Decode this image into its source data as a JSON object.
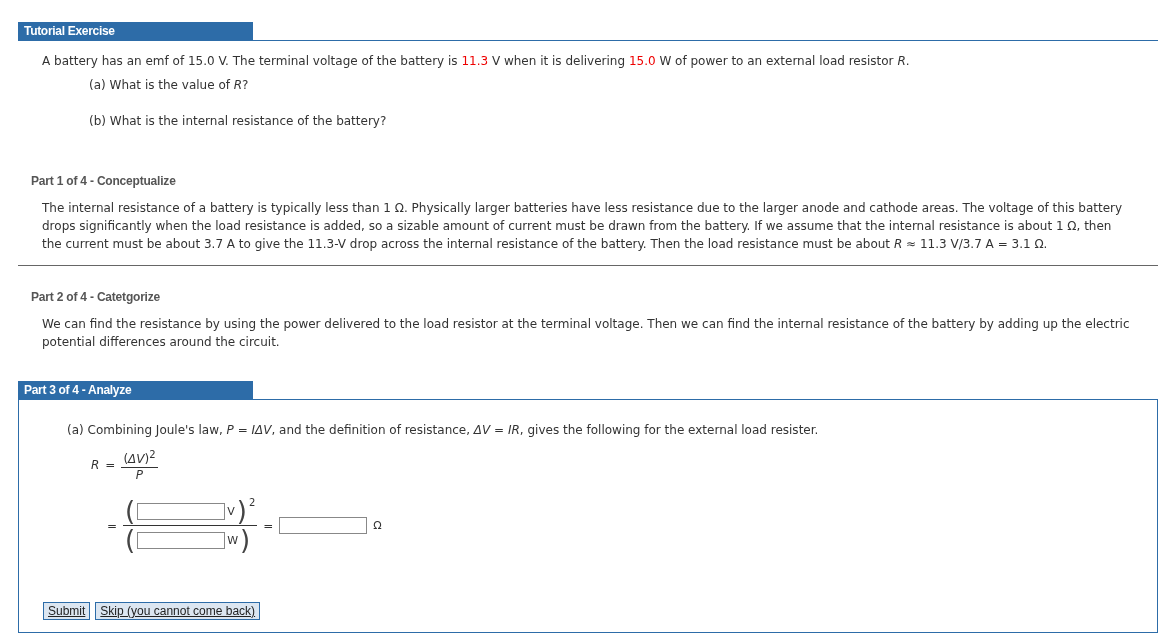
{
  "tutorial": {
    "title": "Tutorial Exercise",
    "problem": [
      {
        "text": "A battery has an emf of 15.0 V. The terminal voltage of the battery is ",
        "kind": "plain"
      },
      {
        "text": "11.3",
        "kind": "given"
      },
      {
        "text": " V when it is delivering ",
        "kind": "plain"
      },
      {
        "text": "15.0",
        "kind": "given"
      },
      {
        "text": " W of power to an external load resistor *R*.",
        "kind": "plain"
      }
    ],
    "questions": [
      "(a) What is the value of *R*?",
      "(b) What is the internal resistance of the battery?"
    ]
  },
  "parts": [
    {
      "title": "Part 1 of 4 - Conceptualize",
      "active": false,
      "text": "The internal resistance of a battery is typically less than 1 Ω. Physically larger batteries have less resistance due to the larger anode and cathode areas. The voltage of this battery drops significantly when the load resistance is added, so a sizable amount of current must be drawn from the battery. If we assume that the internal resistance is about 1 Ω, then the current must be about 3.7 A to give the 11.3-V drop across the internal resistance of the battery. Then the load resistance must be about *R* ≈ 11.3 V/3.7 A = 3.1 Ω."
    },
    {
      "title": "Part 2 of 4 - Catetgorize",
      "active": false,
      "text": "We can find the resistance by using the power delivered to the load resistor at the terminal voltage. Then we can find the internal resistance of the battery by adding up the electric potential differences around the circuit."
    },
    {
      "title": "Part 3 of 4 - Analyze",
      "active": true,
      "text": "(a) Combining Joule's law, *P* = *IΔV*, and the definition of resistance, *ΔV* = *IR*, gives the following for the external load resister.",
      "formula": {
        "lhs": "R",
        "eq": "=",
        "numerator": "(*ΔV*)$^{2}$",
        "denominator": "P"
      },
      "work": {
        "eq": "=",
        "open": "(",
        "close": ")",
        "num_unit": "V",
        "exponent": "2",
        "den_unit": "W",
        "eq2": "=",
        "result_unit": "Ω"
      },
      "buttons": [
        "Submit",
        "Skip (you cannot come back)"
      ]
    }
  ]
}
